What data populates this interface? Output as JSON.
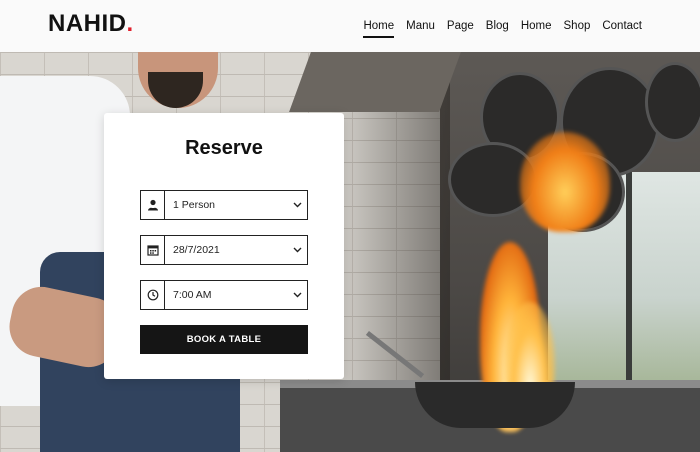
{
  "brand": {
    "name": "NAHID",
    "accent_dot": ".",
    "accent_color": "#e01e2b"
  },
  "nav": {
    "items": [
      {
        "label": "Home",
        "active": true
      },
      {
        "label": "Manu",
        "active": false
      },
      {
        "label": "Page",
        "active": false
      },
      {
        "label": "Blog",
        "active": false
      },
      {
        "label": "Home",
        "active": false
      },
      {
        "label": "Shop",
        "active": false
      },
      {
        "label": "Contact",
        "active": false
      }
    ]
  },
  "reserve": {
    "title": "Reserve",
    "person": {
      "icon": "person-icon",
      "value": "1 Person"
    },
    "date": {
      "icon": "calendar-icon",
      "value": "28/7/2021"
    },
    "time": {
      "icon": "clock-icon",
      "value": "7:00 AM"
    },
    "button_label": "BOOK A TABLE"
  },
  "hero": {
    "image": "chef-flambe-photo"
  }
}
